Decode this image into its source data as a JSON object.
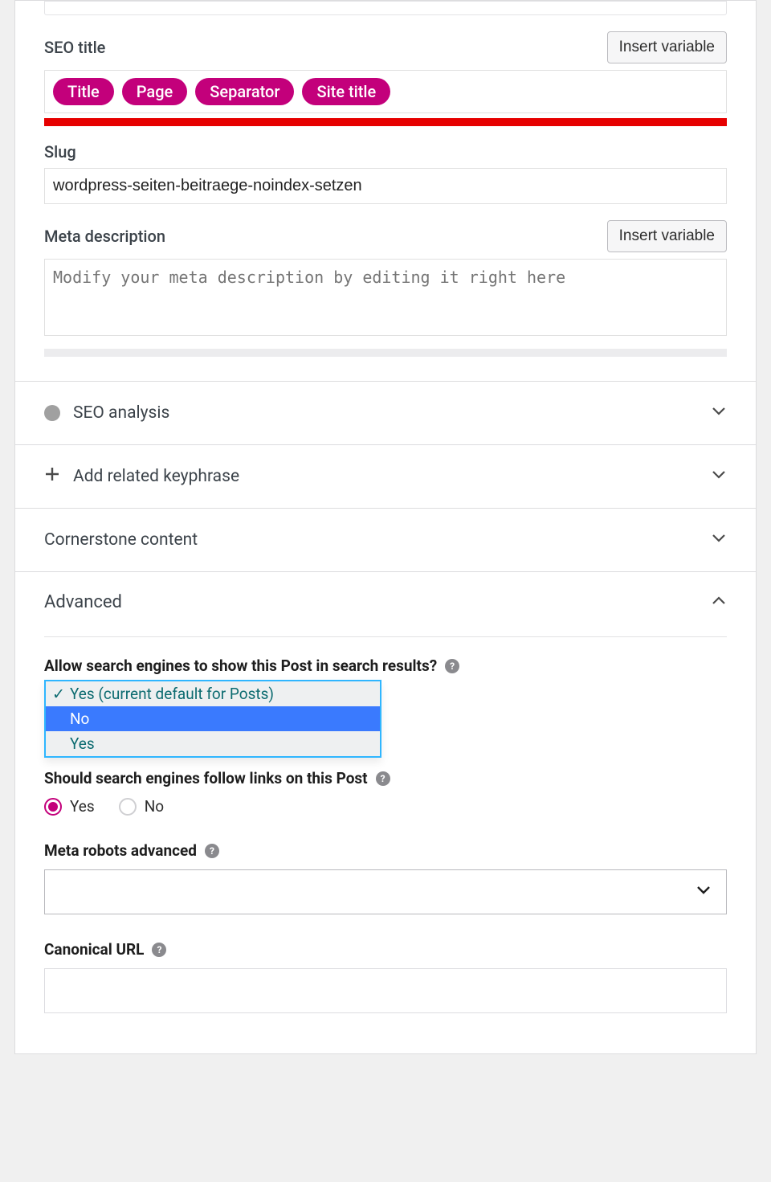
{
  "seo_title": {
    "label": "SEO title",
    "insert_btn": "Insert variable",
    "chips": [
      "Title",
      "Page",
      "Separator",
      "Site title"
    ]
  },
  "slug": {
    "label": "Slug",
    "value": "wordpress-seiten-beitraege-noindex-setzen"
  },
  "meta_desc": {
    "label": "Meta description",
    "insert_btn": "Insert variable",
    "placeholder": "Modify your meta description by editing it right here"
  },
  "accordions": {
    "seo_analysis": "SEO analysis",
    "add_keyphrase": "Add related keyphrase",
    "cornerstone": "Cornerstone content",
    "advanced": "Advanced"
  },
  "advanced": {
    "q_index": "Allow search engines to show this Post in search results?",
    "opt_default": "Yes (current default for Posts)",
    "opt_no": "No",
    "opt_yes": "Yes",
    "q_follow": "Should search engines follow links on this Post",
    "radio_yes": "Yes",
    "radio_no": "No",
    "meta_robots": "Meta robots advanced",
    "canonical": "Canonical URL"
  }
}
